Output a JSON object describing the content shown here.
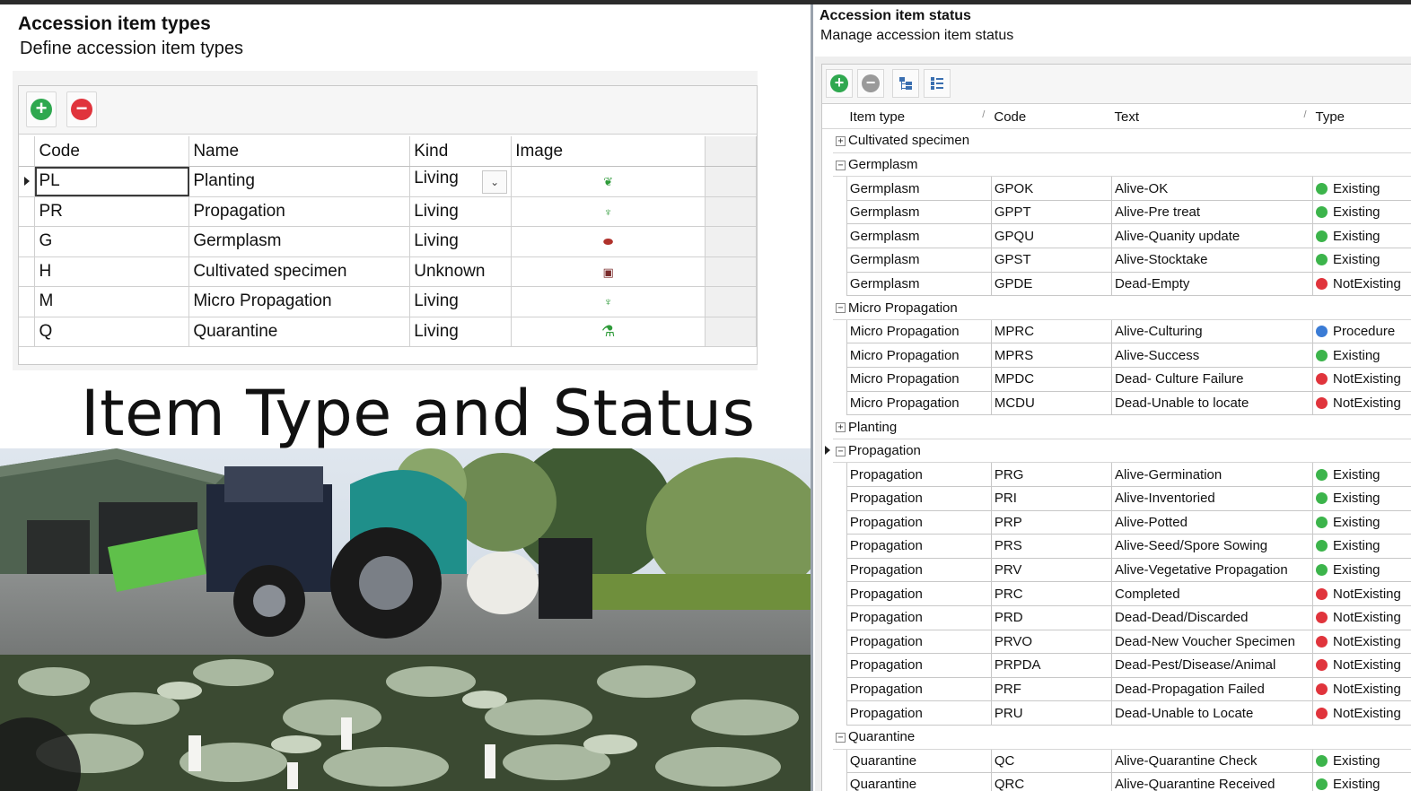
{
  "left": {
    "title": "Accession item types",
    "subtitle": "Define accession item types",
    "toolbar": {
      "add_icon": "plus-circle-icon",
      "remove_icon": "minus-circle-icon"
    },
    "columns": [
      "Code",
      "Name",
      "Kind",
      "Image"
    ],
    "rows": [
      {
        "code": "PL",
        "name": "Planting",
        "kind": "Living",
        "image_icon": "leaf-icon"
      },
      {
        "code": "PR",
        "name": "Propagation",
        "kind": "Living",
        "image_icon": "seedling-pot-icon"
      },
      {
        "code": "G",
        "name": "Germplasm",
        "kind": "Living",
        "image_icon": "seed-icon"
      },
      {
        "code": "H",
        "name": "Cultivated specimen",
        "kind": "Unknown",
        "image_icon": "herbarium-sheet-icon"
      },
      {
        "code": "M",
        "name": "Micro Propagation",
        "kind": "Living",
        "image_icon": "seedling-pot-icon"
      },
      {
        "code": "Q",
        "name": "Quarantine",
        "kind": "Living",
        "image_icon": "quarantine-icon"
      }
    ],
    "colors": {
      "add": "#2fa84f",
      "remove": "#e0343c",
      "icon": "#2f9b3a"
    }
  },
  "overlay_title": "Item Type and Status",
  "photo": {
    "description_icon": "nursery-photo"
  },
  "right": {
    "title": "Accession item status",
    "subtitle": "Manage accession item status",
    "columns": [
      "Item type",
      "Code",
      "Text",
      "Type"
    ],
    "groups": [
      {
        "name": "Cultivated specimen",
        "expanded": false,
        "rows": []
      },
      {
        "name": "Germplasm",
        "expanded": true,
        "rows": [
          {
            "item_type": "Germplasm",
            "code": "GPOK",
            "text": "Alive-OK",
            "type": "Existing"
          },
          {
            "item_type": "Germplasm",
            "code": "GPPT",
            "text": "Alive-Pre treat",
            "type": "Existing"
          },
          {
            "item_type": "Germplasm",
            "code": "GPQU",
            "text": "Alive-Quanity update",
            "type": "Existing"
          },
          {
            "item_type": "Germplasm",
            "code": "GPST",
            "text": "Alive-Stocktake",
            "type": "Existing"
          },
          {
            "item_type": "Germplasm",
            "code": "GPDE",
            "text": "Dead-Empty",
            "type": "NotExisting"
          }
        ]
      },
      {
        "name": "Micro Propagation",
        "expanded": true,
        "rows": [
          {
            "item_type": "Micro Propagation",
            "code": "MPRC",
            "text": "Alive-Culturing",
            "type": "Procedure"
          },
          {
            "item_type": "Micro Propagation",
            "code": "MPRS",
            "text": "Alive-Success",
            "type": "Existing"
          },
          {
            "item_type": "Micro Propagation",
            "code": "MPDC",
            "text": "Dead- Culture Failure",
            "type": "NotExisting"
          },
          {
            "item_type": "Micro Propagation",
            "code": "MCDU",
            "text": "Dead-Unable to locate",
            "type": "NotExisting"
          }
        ]
      },
      {
        "name": "Planting",
        "expanded": false,
        "rows": []
      },
      {
        "name": "Propagation",
        "expanded": true,
        "rows": [
          {
            "item_type": "Propagation",
            "code": "PRG",
            "text": "Alive-Germination",
            "type": "Existing"
          },
          {
            "item_type": "Propagation",
            "code": "PRI",
            "text": "Alive-Inventoried",
            "type": "Existing"
          },
          {
            "item_type": "Propagation",
            "code": "PRP",
            "text": "Alive-Potted",
            "type": "Existing"
          },
          {
            "item_type": "Propagation",
            "code": "PRS",
            "text": "Alive-Seed/Spore Sowing",
            "type": "Existing"
          },
          {
            "item_type": "Propagation",
            "code": "PRV",
            "text": "Alive-Vegetative Propagation",
            "type": "Existing"
          },
          {
            "item_type": "Propagation",
            "code": "PRC",
            "text": "Completed",
            "type": "NotExisting"
          },
          {
            "item_type": "Propagation",
            "code": "PRD",
            "text": "Dead-Dead/Discarded",
            "type": "NotExisting"
          },
          {
            "item_type": "Propagation",
            "code": "PRVO",
            "text": "Dead-New Voucher Specimen",
            "type": "NotExisting"
          },
          {
            "item_type": "Propagation",
            "code": "PRPDA",
            "text": "Dead-Pest/Disease/Animal",
            "type": "NotExisting"
          },
          {
            "item_type": "Propagation",
            "code": "PRF",
            "text": "Dead-Propagation Failed",
            "type": "NotExisting"
          },
          {
            "item_type": "Propagation",
            "code": "PRU",
            "text": "Dead-Unable to Locate",
            "type": "NotExisting"
          }
        ]
      },
      {
        "name": "Quarantine",
        "expanded": true,
        "rows": [
          {
            "item_type": "Quarantine",
            "code": "QC",
            "text": "Alive-Quarantine Check",
            "type": "Existing"
          },
          {
            "item_type": "Quarantine",
            "code": "QRC",
            "text": "Alive-Quarantine Received",
            "type": "Existing"
          }
        ]
      }
    ],
    "type_colors": {
      "Existing": "#3cb44b",
      "NotExisting": "#e0343c",
      "Procedure": "#3a7bd5"
    }
  }
}
